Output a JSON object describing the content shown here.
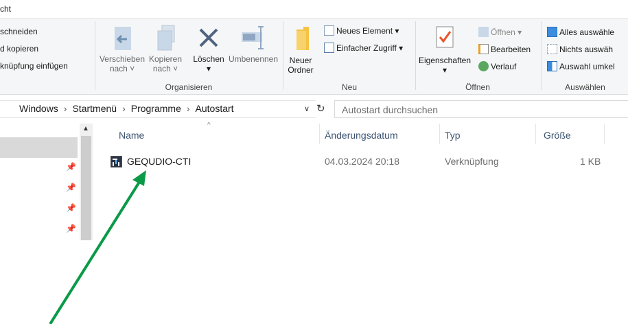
{
  "tabstrip": {
    "partial_tab": "cht"
  },
  "ribbon": {
    "clipboard": {
      "cut_label": "schneiden",
      "copy_path_label": "d kopieren",
      "paste_shortcut_label": "knüpfung einfügen"
    },
    "organize": {
      "move_to": "Verschieben",
      "move_to_sub": "nach",
      "copy_to": "Kopieren",
      "copy_to_sub": "nach",
      "delete": "Löschen",
      "rename": "Umbenennen",
      "group_label": "Organisieren"
    },
    "new": {
      "new_folder_l1": "Neuer",
      "new_folder_l2": "Ordner",
      "new_item": "Neues Element",
      "easy_access": "Einfacher Zugriff",
      "group_label": "Neu"
    },
    "open": {
      "properties": "Eigenschaften",
      "open_label": "Öffnen",
      "edit_label": "Bearbeiten",
      "history_label": "Verlauf",
      "group_label": "Öffnen"
    },
    "select": {
      "select_all": "Alles auswähle",
      "select_none": "Nichts auswäh",
      "invert_selection": "Auswahl umkel",
      "group_label": "Auswählen"
    }
  },
  "address": {
    "crumbs": [
      "Windows",
      "Startmenü",
      "Programme",
      "Autostart"
    ],
    "search_placeholder": "Autostart durchsuchen"
  },
  "file_list": {
    "columns": [
      "Name",
      "Änderungsdatum",
      "Typ",
      "Größe"
    ],
    "rows": [
      {
        "name": "GEQUDIO-CTI",
        "date": "04.03.2024 20:18",
        "type": "Verknüpfung",
        "size": "1 KB"
      }
    ]
  },
  "colors": {
    "arrow": "#0a9a48",
    "header_text": "#3b5371",
    "ribbon_bg": "#f5f6f7"
  },
  "icons": [
    "scissors-icon",
    "move-to-icon",
    "copy-to-icon",
    "delete-icon",
    "rename-icon",
    "new-folder-icon",
    "new-item-icon",
    "easy-access-icon",
    "properties-icon",
    "open-icon",
    "edit-icon",
    "history-icon",
    "select-all-icon",
    "select-none-icon",
    "invert-selection-icon",
    "refresh-icon",
    "pin-icon",
    "shortcut-file-icon"
  ]
}
